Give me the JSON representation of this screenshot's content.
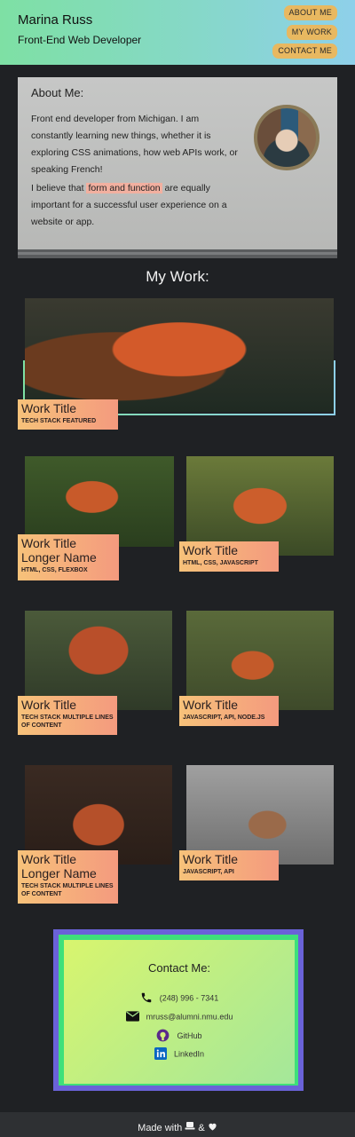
{
  "header": {
    "name": "Marina Russ",
    "role": "Front-End Web Developer",
    "nav": [
      "ABOUT ME",
      "MY WORK",
      "CONTACT ME"
    ]
  },
  "about": {
    "title": "About Me:",
    "p1": "Front end developer from Michigan. I am constantly learning new things, whether it is exploring CSS animations, how web APIs work, or speaking French!",
    "p2_before": "I believe that",
    "p2_highlight": "form and function",
    "p2_after": "are equally important for a successful user experience on a website or app."
  },
  "work": {
    "heading": "My Work:",
    "items": [
      {
        "title": "Work Title",
        "stack": "TECH STACK FEATURED"
      },
      {
        "title": "Work Title Longer Name",
        "stack": "HTML, CSS, FLEXBOX"
      },
      {
        "title": "Work Title",
        "stack": "HTML, CSS, JAVASCRIPT"
      },
      {
        "title": "Work Title",
        "stack": "TECH STACK MULTIPLE LINES OF CONTENT"
      },
      {
        "title": "Work Title",
        "stack": "JAVASCRIPT, API, NODE.JS"
      },
      {
        "title": "Work Title Longer Name",
        "stack": "TECH STACK MULTIPLE LINES OF CONTENT"
      },
      {
        "title": "Work Title",
        "stack": "JAVASCRIPT, API"
      }
    ]
  },
  "contact": {
    "title": "Contact Me:",
    "phone": "(248) 996 - 7341",
    "email": "mruss@alumni.nmu.edu",
    "github": "GitHub",
    "linkedin": "LinkedIn"
  },
  "footer": {
    "made_with": "Made with",
    "amp": "&"
  },
  "colors": {
    "header_gradient": [
      "#7ee0a4",
      "#8ed0ea"
    ],
    "nav_button": "#e8b860",
    "label_gradient": [
      "#f7c27a",
      "#f49a7e"
    ],
    "contact_gradient": [
      "#d8f56e",
      "#a4e79a"
    ],
    "background": "#1f2124"
  }
}
